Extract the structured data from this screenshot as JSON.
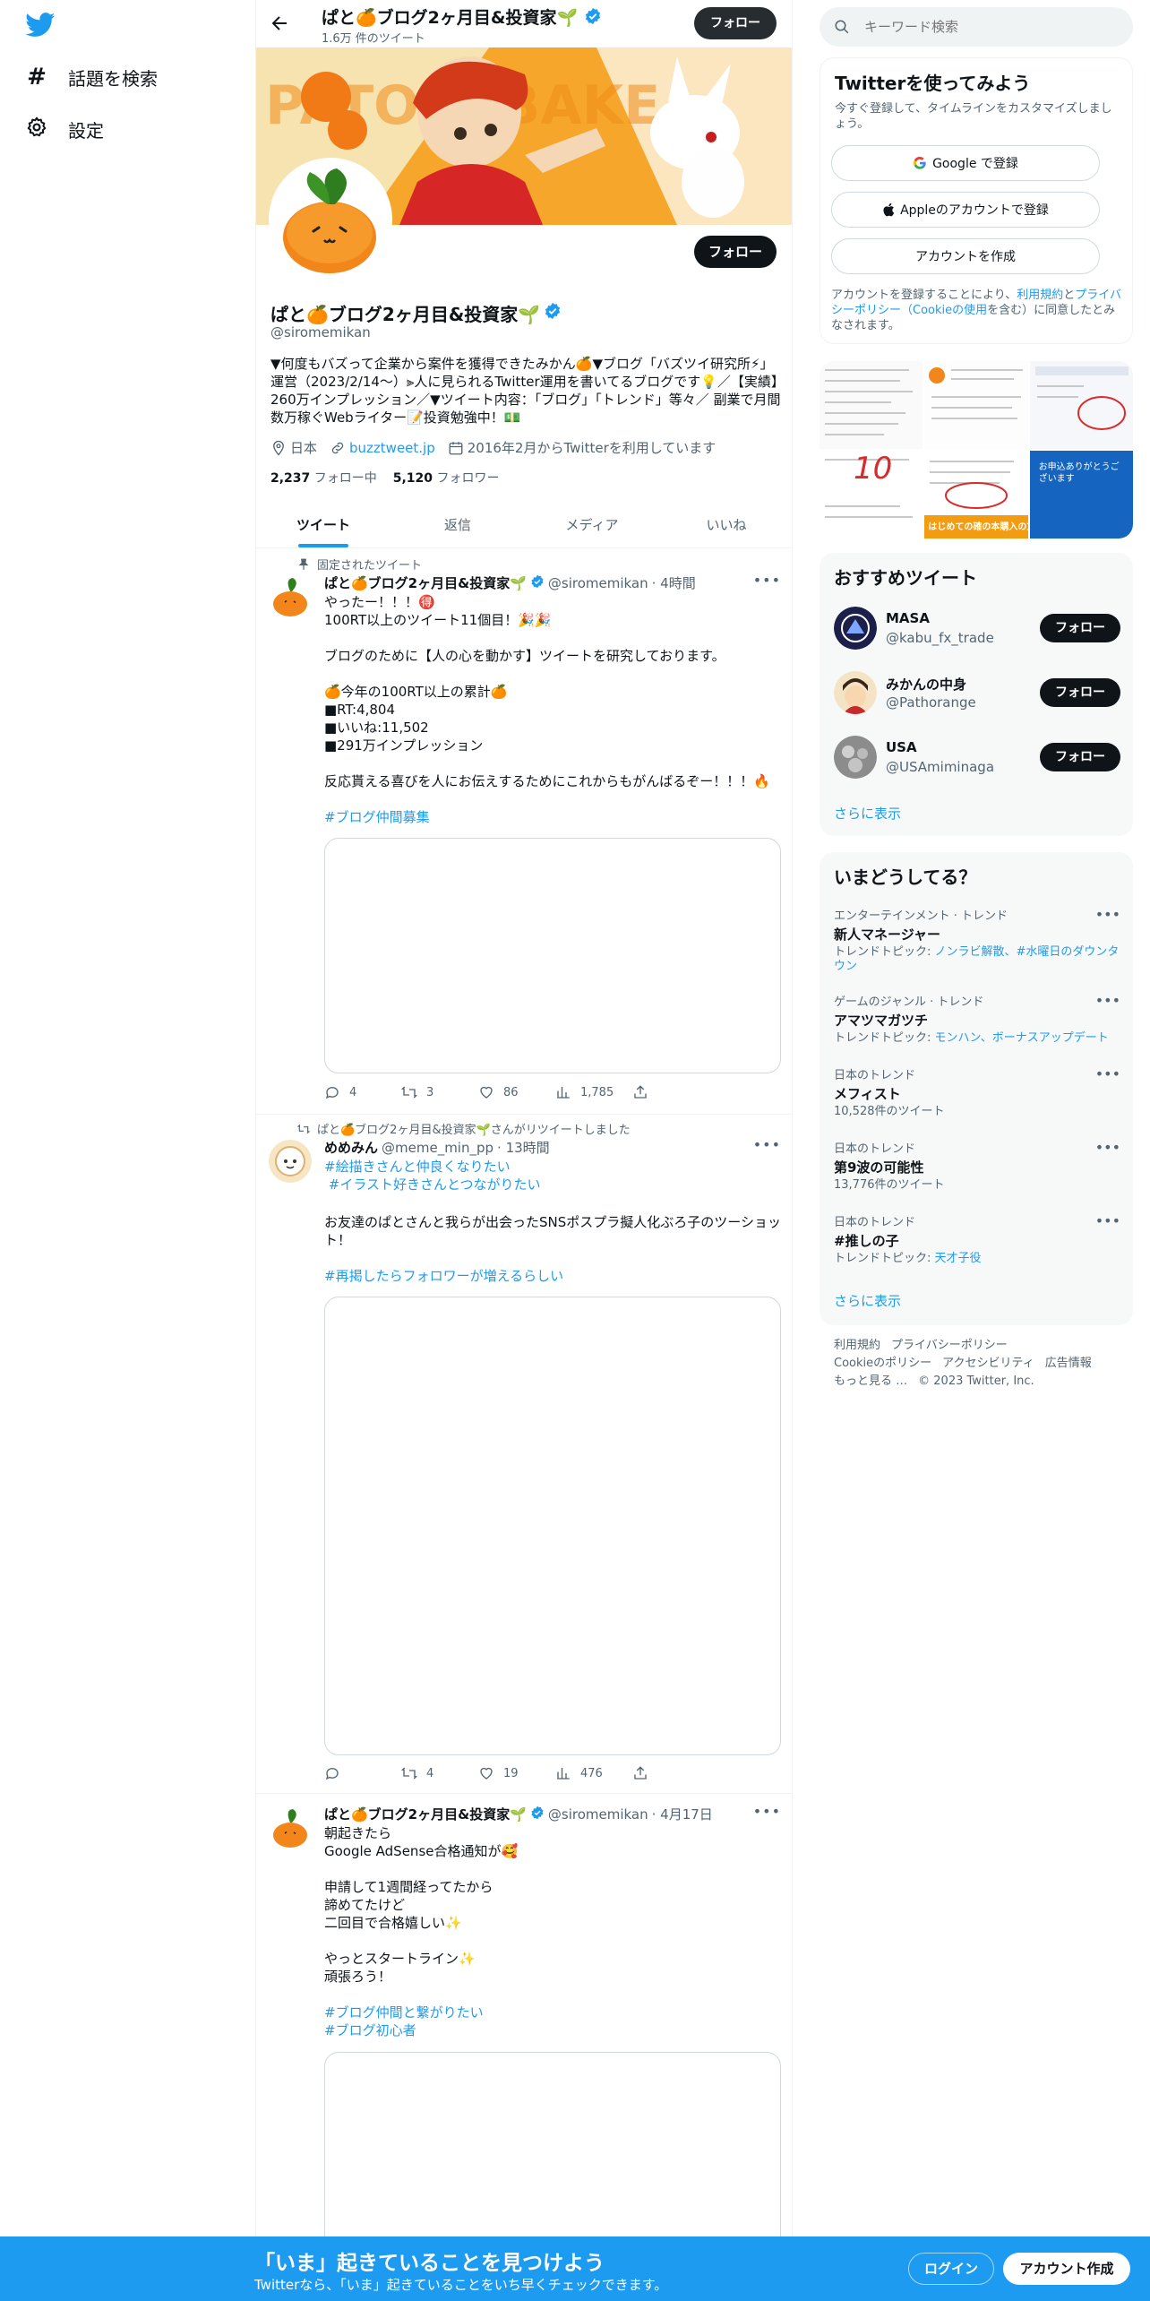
{
  "nav": {
    "explore_label": "話題を検索",
    "settings_label": "設定"
  },
  "header": {
    "name": "ぱと🍊ブログ2ヶ月目&投資家🌱",
    "tweet_count": "1.6万 件のツイート",
    "follow_label": "フォロー"
  },
  "profile": {
    "name": "ぱと🍊ブログ2ヶ月目&投資家🌱",
    "handle": "@siromemikan",
    "bio": "▼何度もバズって企業から案件を獲得できたみかん🍊▼ブログ「バズツイ研究所⚡」運営（2023/2/14～）⫸人に見られるTwitter運用を書いてるブログです💡／【実績】260万インプレッション／▼ツイート内容：「ブログ」「トレンド」等々／ 副業で月間数万稼ぐWebライター📝投資勉強中！💵",
    "location": "日本",
    "url": "buzztweet.jp",
    "joined": "2016年2月からTwitterを利用しています",
    "following_count": "2,237",
    "following_label": "フォロー中",
    "followers_count": "5,120",
    "followers_label": "フォロワー",
    "follow_label": "フォロー",
    "banner_text": "PATO  RIBAKE"
  },
  "tabs": [
    "ツイート",
    "返信",
    "メディア",
    "いいね"
  ],
  "tweets": [
    {
      "context": "固定されたツイート",
      "name": "ぱと🍊ブログ2ヶ月目&投資家🌱",
      "handle": "@siromemikan",
      "time": "· 4時間",
      "text": "やったー！！！🉐\n100RT以上のツイート11個目！🎉🎉\n\nブログのために【人の心を動かす】ツイートを研究しております。\n\n🍊今年の100RT以上の累計🍊\n■RT:4,804\n■いいね:11,502\n■291万インプレッション\n\n反応貰える喜びを人にお伝えするためにこれからもがんばるぞー！！！🔥",
      "hashtags": "#ブログ仲間募集",
      "replies": "4",
      "retweets": "3",
      "likes": "86",
      "views": "1,785"
    },
    {
      "context": "ぱと🍊ブログ2ヶ月目&投資家🌱さんがリツイートしました",
      "name": "めめみん",
      "handle": "@meme_min_pp",
      "time": "· 13時間",
      "hashtags": "#絵描きさんと仲良くなりたい\n #イラスト好きさんとつながりたい",
      "text": "お友達のぱとさんと我らが出会ったSNSポスプラ擬人化ぶろ子のツーショット！",
      "hashtags2": "#再掲したらフォロワーが増えるらしい",
      "replies": "",
      "retweets": "4",
      "likes": "19",
      "views": "476"
    },
    {
      "name": "ぱと🍊ブログ2ヶ月目&投資家🌱",
      "handle": "@siromemikan",
      "time": "· 4月17日",
      "text": "朝起きたら\nGoogle AdSense合格通知が🥰\n\n申請して1週間経ってたから\n諦めてたけど\n二回目で合格嬉しい✨\n\nやっとスタートライン✨\n頑張ろう！",
      "hashtags": "#ブログ仲間と繋がりたい\n#ブログ初心者"
    }
  ],
  "search": {
    "placeholder": "キーワード検索"
  },
  "signup_card": {
    "title": "Twitterを使ってみよう",
    "subtitle": "今すぐ登録して、タイムラインをカスタマイズしましょう。",
    "google_label": "Google で登録",
    "apple_label": "Appleのアカウントで登録",
    "create_label": "アカウントを作成",
    "terms_prefix": "アカウントを登録することにより、",
    "terms_link": "利用規約",
    "terms_mid": "と",
    "privacy_link": "プライバシーポリシー",
    "cookie_link": "（Cookieの使用",
    "terms_suffix": "を含む）に同意したとみなされます。"
  },
  "photo_grid": {
    "badge": "10",
    "note1": "はじめての確の本購入の方へ",
    "note2": "お申込ありがとうございます"
  },
  "who_to_follow": {
    "title": "おすすめツイート",
    "users": [
      {
        "name": "MASA",
        "handle": "@kabu_fx_trade",
        "button": "フォロー"
      },
      {
        "name": "みかんの中身",
        "handle": "@Pathorange",
        "button": "フォロー"
      },
      {
        "name": "USA",
        "handle": "@USAmiminaga",
        "button": "フォロー"
      }
    ],
    "show_more": "さらに表示"
  },
  "trends": {
    "title": "いまどうしてる？",
    "items": [
      {
        "category": "エンターテインメント · トレンド",
        "name": "新人マネージャー",
        "sub_prefix": "トレンドトピック: ",
        "sub_links": "ノンラビ解散、#水曜日のダウンタウン"
      },
      {
        "category": "ゲームのジャンル · トレンド",
        "name": "アマツマガツチ",
        "sub_prefix": "トレンドトピック: ",
        "sub_links": "モンハン、ボーナスアップデート"
      },
      {
        "category": "日本のトレンド",
        "name": "メフィスト",
        "sub_prefix": "10,528件のツイート",
        "sub_links": ""
      },
      {
        "category": "日本のトレンド",
        "name": "第9波の可能性",
        "sub_prefix": "13,776件のツイート",
        "sub_links": ""
      },
      {
        "category": "日本のトレンド",
        "name": "#推しの子",
        "sub_prefix": "トレンドトピック: ",
        "sub_links": "天才子役"
      }
    ],
    "show_more": "さらに表示"
  },
  "footer": {
    "links": [
      "利用規約",
      "プライバシーポリシー",
      "Cookieのポリシー",
      "アクセシビリティ",
      "広告情報",
      "もっと見る …",
      "© 2023 Twitter, Inc."
    ]
  },
  "bottom_bar": {
    "title": "「いま」起きていることを見つけよう",
    "subtitle": "Twitterなら、「いま」起きていることをいち早くチェックできます。",
    "login_label": "ログイン",
    "signup_label": "アカウント作成"
  },
  "colors": {
    "accent": "#1d9bf0",
    "text": "#0f1419",
    "muted": "#536471"
  }
}
